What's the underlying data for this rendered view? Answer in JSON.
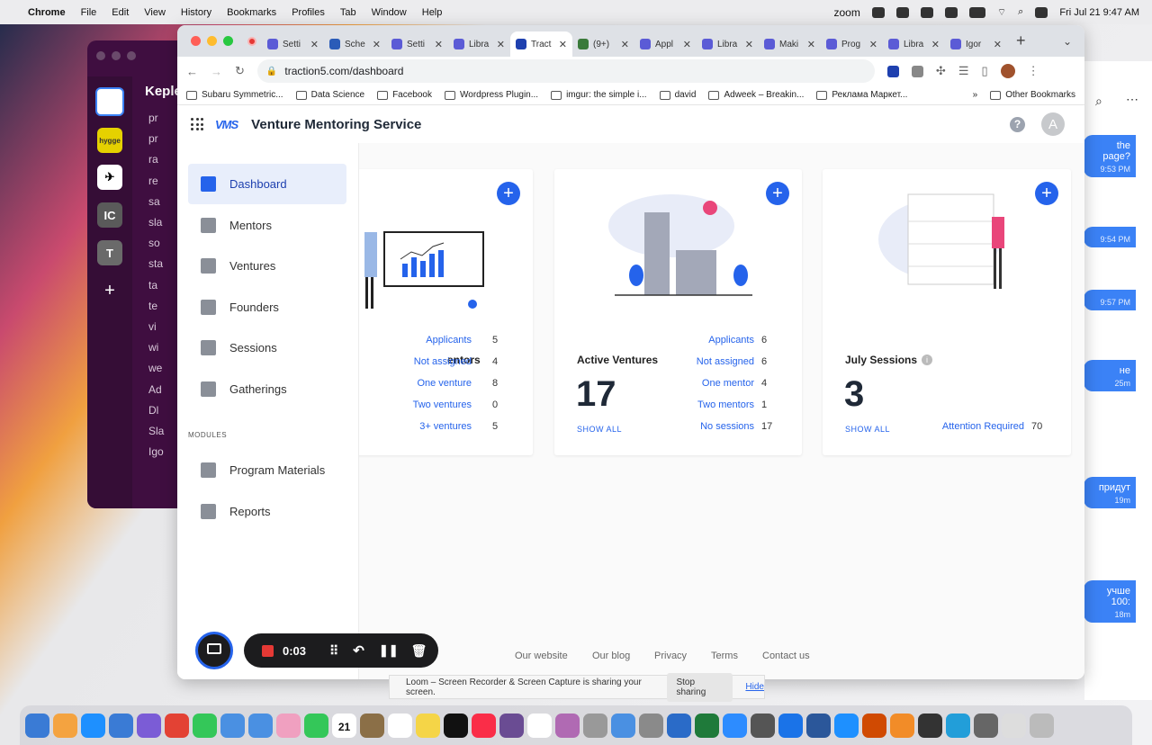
{
  "menubar": {
    "apple": "",
    "app": "Chrome",
    "items": [
      "File",
      "Edit",
      "View",
      "History",
      "Bookmarks",
      "Profiles",
      "Tab",
      "Window",
      "Help"
    ],
    "zoom": "zoom",
    "datetime": "Fri Jul 21  9:47 AM"
  },
  "slack": {
    "workspace": "Keple",
    "channels": [
      "pr",
      "pr",
      "ra",
      "re",
      "sa",
      "sla",
      "so",
      "sta",
      "ta",
      "te",
      "vi",
      "wi",
      "we",
      "Ad",
      "Dl",
      "Sla",
      "Igo"
    ],
    "rail_labels": [
      "IC",
      "T",
      "+"
    ]
  },
  "messenger": {
    "messages": [
      {
        "text": "the page?",
        "time": "9:53 PM"
      },
      {
        "text": "",
        "time": "9:54 PM"
      },
      {
        "text": "",
        "time": "9:57 PM"
      },
      {
        "text": "не",
        "time": "25m"
      },
      {
        "text": "придут",
        "time": "19m"
      },
      {
        "text": "учше 100:",
        "time": "18m"
      }
    ]
  },
  "tabs": [
    {
      "title": "Setti",
      "fav": "#5b5bd6",
      "active": false
    },
    {
      "title": "Sche",
      "fav": "#2b5cb8",
      "active": false
    },
    {
      "title": "Setti",
      "fav": "#5b5bd6",
      "active": false
    },
    {
      "title": "Libra",
      "fav": "#5b5bd6",
      "active": false
    },
    {
      "title": "Tract",
      "fav": "#1e40af",
      "active": true
    },
    {
      "title": "(9+)",
      "fav": "#3a7a3a",
      "active": false
    },
    {
      "title": "Appl",
      "fav": "#5b5bd6",
      "active": false
    },
    {
      "title": "Libra",
      "fav": "#5b5bd6",
      "active": false
    },
    {
      "title": "Maki",
      "fav": "#5b5bd6",
      "active": false
    },
    {
      "title": "Prog",
      "fav": "#5b5bd6",
      "active": false
    },
    {
      "title": "Libra",
      "fav": "#5b5bd6",
      "active": false
    },
    {
      "title": "Igor",
      "fav": "#5b5bd6",
      "active": false
    }
  ],
  "address": {
    "url": "traction5.com/dashboard"
  },
  "bookmarks": [
    "Subaru Symmetric...",
    "Data Science",
    "Facebook",
    "Wordpress Plugin...",
    "imgur: the simple i...",
    "david",
    "Adweek – Breakin...",
    "Реклама Маркет...",
    "»",
    "Other Bookmarks"
  ],
  "app": {
    "logo": "VMS",
    "title": "Venture Mentoring Service",
    "help": "?",
    "avatar": "A"
  },
  "nav": [
    {
      "label": "Dashboard",
      "active": true
    },
    {
      "label": "Mentors",
      "active": false
    },
    {
      "label": "Ventures",
      "active": false
    },
    {
      "label": "Founders",
      "active": false
    },
    {
      "label": "Sessions",
      "active": false
    },
    {
      "label": "Gatherings",
      "active": false
    }
  ],
  "modules_label": "MODULES",
  "modules": [
    {
      "label": "Program Materials"
    },
    {
      "label": "Reports"
    }
  ],
  "cards": [
    {
      "title": "entors",
      "stats": [
        {
          "label": "Applicants",
          "value": "5"
        },
        {
          "label": "Not assigned",
          "value": "4"
        },
        {
          "label": "One venture",
          "value": "8"
        },
        {
          "label": "Two ventures",
          "value": "0"
        },
        {
          "label": "3+ ventures",
          "value": "5"
        }
      ]
    },
    {
      "title": "Active Ventures",
      "number": "17",
      "show_all": "SHOW ALL",
      "stats": [
        {
          "label": "Applicants",
          "value": "6"
        },
        {
          "label": "Not assigned",
          "value": "6"
        },
        {
          "label": "One mentor",
          "value": "4"
        },
        {
          "label": "Two mentors",
          "value": "1"
        },
        {
          "label": "No sessions",
          "value": "17"
        }
      ]
    },
    {
      "title": "July Sessions",
      "number": "3",
      "show_all": "SHOW ALL",
      "stats": [
        {
          "label": "Attention Required",
          "value": "70"
        }
      ]
    }
  ],
  "footer": [
    "Our website",
    "Our blog",
    "Privacy",
    "Terms",
    "Contact us"
  ],
  "loom": {
    "time": "0:03"
  },
  "share": {
    "text": "Loom – Screen Recorder & Screen Capture is sharing your screen.",
    "stop": "Stop sharing",
    "hide": "Hide"
  },
  "dock_date": "21",
  "colors": {
    "accent": "#2563eb",
    "record": "#e53935"
  }
}
